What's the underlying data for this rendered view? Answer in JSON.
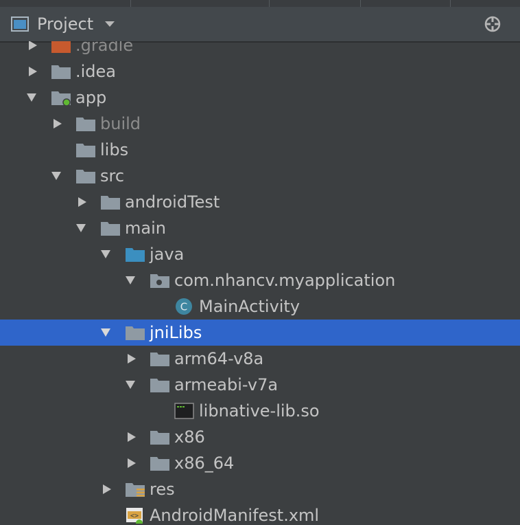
{
  "panel": {
    "title": "Project",
    "view_mode_icon": "project-view-icon",
    "dropdown_icon": "chevron-down-icon",
    "locate_icon": "crosshair-icon"
  },
  "colors": {
    "background": "#3c3f41",
    "selection": "#2f65ca",
    "folder": "#8f9aa3",
    "source_folder": "#3b8fc0",
    "excluded_folder": "#c75a2e",
    "class_badge": "#3e86a0"
  },
  "tree": [
    {
      "label": ".gradle",
      "state": "collapsed",
      "icon": "excluded-folder-icon"
    },
    {
      "label": ".idea",
      "state": "collapsed",
      "icon": "folder-icon"
    },
    {
      "label": "app",
      "state": "expanded",
      "icon": "module-folder-icon"
    },
    {
      "label": "build",
      "state": "collapsed",
      "icon": "folder-icon"
    },
    {
      "label": "libs",
      "state": "leaf",
      "icon": "folder-icon"
    },
    {
      "label": "src",
      "state": "expanded",
      "icon": "folder-icon"
    },
    {
      "label": "androidTest",
      "state": "collapsed",
      "icon": "folder-icon"
    },
    {
      "label": "main",
      "state": "expanded",
      "icon": "folder-icon"
    },
    {
      "label": "java",
      "state": "expanded",
      "icon": "source-folder-icon"
    },
    {
      "label": "com.nhancv.myapplication",
      "state": "expanded",
      "icon": "package-icon"
    },
    {
      "label": "MainActivity",
      "state": "leaf",
      "icon": "class-icon"
    },
    {
      "label": "jniLibs",
      "state": "expanded",
      "icon": "folder-icon",
      "selected": true
    },
    {
      "label": "arm64-v8a",
      "state": "collapsed",
      "icon": "folder-icon"
    },
    {
      "label": "armeabi-v7a",
      "state": "expanded",
      "icon": "folder-icon"
    },
    {
      "label": "libnative-lib.so",
      "state": "leaf",
      "icon": "native-library-icon"
    },
    {
      "label": "x86",
      "state": "collapsed",
      "icon": "folder-icon"
    },
    {
      "label": "x86_64",
      "state": "collapsed",
      "icon": "folder-icon"
    },
    {
      "label": "res",
      "state": "collapsed",
      "icon": "resource-folder-icon"
    },
    {
      "label": "AndroidManifest.xml",
      "state": "leaf",
      "icon": "manifest-icon"
    }
  ]
}
